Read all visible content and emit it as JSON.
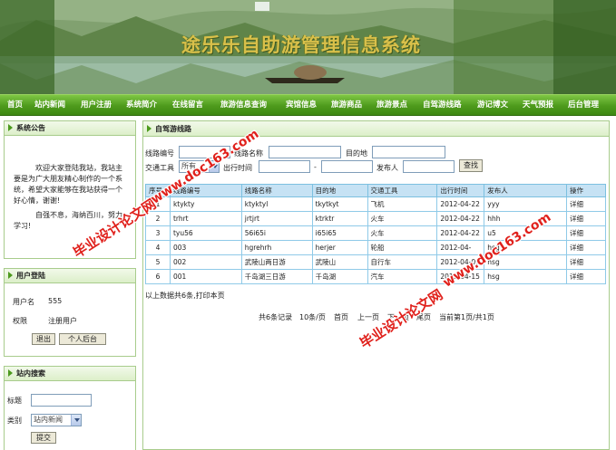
{
  "banner": {
    "title": "途乐乐自助游管理信息系统"
  },
  "nav": [
    "首页",
    "站内新闻",
    "用户注册",
    "系统简介",
    "在线留言",
    "旅游信息查询",
    "宾馆信息",
    "旅游商品",
    "旅游景点",
    "自驾游线路",
    "游记博文",
    "天气预报",
    "后台管理"
  ],
  "notice": {
    "title": "系统公告",
    "para1": "欢迎大家登陆我站，我站主要是为广大朋友精心制作的一个系统，希望大家能够在我站获得一个好心情，谢谢!",
    "para2": "自强不息，海纳百川，努力学习!"
  },
  "login": {
    "title": "用户登陆",
    "username_label": "用户名",
    "username": "555",
    "role_label": "权限",
    "role": "注册用户",
    "logout_button": "退出",
    "profile_button": "个人后台"
  },
  "search_side": {
    "title": "站内搜索",
    "keyword_label": "标题",
    "keyword_value": "",
    "category_label": "类别",
    "category_value": "站内新闻",
    "submit_button": "提交"
  },
  "main": {
    "title": "自驾游线路",
    "filters": {
      "code_label": "线路编号",
      "name_label": "线路名称",
      "dest_label": "目的地",
      "transport_label": "交通工具",
      "transport_value": "所有",
      "time_label": "出行时间",
      "range_sep": "-",
      "publisher_label": "发布人",
      "search_button": "查找"
    },
    "table": {
      "headers": [
        "序号",
        "线路编号",
        "线路名称",
        "目的地",
        "交通工具",
        "出行时间",
        "发布人",
        "操作"
      ],
      "rows": [
        [
          "1",
          "ktykty",
          "ktyktyl",
          "tkytkyt",
          "飞机",
          "2012-04-22",
          "yyy",
          "详细"
        ],
        [
          "2",
          "trhrt",
          "jrtjrt",
          "ktrktr",
          "火车",
          "2012-04-22",
          "hhh",
          "详细"
        ],
        [
          "3",
          "tyu56",
          "56i65i",
          "i65i65",
          "火车",
          "2012-04-22",
          "u5",
          "详细"
        ],
        [
          "4",
          "003",
          "hgrehrh",
          "herjer",
          "轮船",
          "2012-04-",
          "hsg",
          "详细"
        ],
        [
          "5",
          "002",
          "武陵山两日游",
          "武陵山",
          "自行车",
          "2012-04-09",
          "hsg",
          "详细"
        ],
        [
          "6",
          "001",
          "千岛湖三日游",
          "千岛湖",
          "汽车",
          "2012-04-15",
          "hsg",
          "详细"
        ]
      ]
    },
    "summary": "以上数据共6条,打印本页",
    "pagination": {
      "total": "共6条记录",
      "per_page": "10条/页",
      "first": "首页",
      "prev": "上一页",
      "next": "下一页",
      "last": "尾页",
      "current": "当前第1页/共1页"
    }
  },
  "watermarks": [
    "毕业设计论文网",
    "www.doc163.com"
  ],
  "colors": {
    "nav": "#4e9a1d",
    "panel_border": "#a8cc8c",
    "table_header": "#c6e2f4",
    "watermark": "#e0211c"
  }
}
